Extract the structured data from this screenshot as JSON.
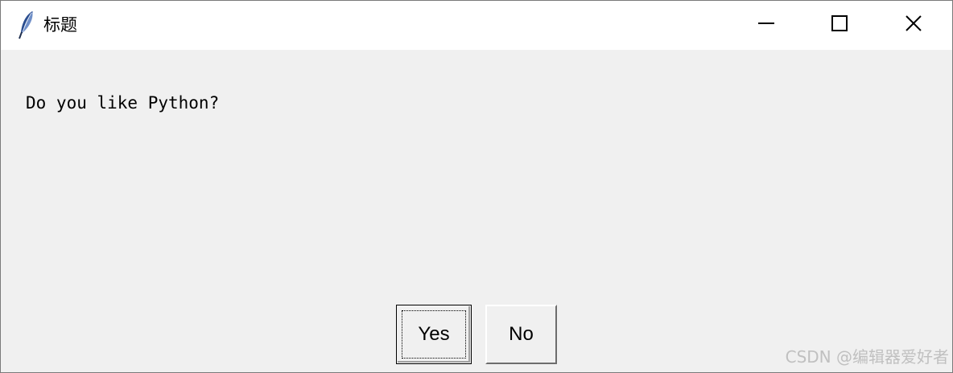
{
  "window": {
    "title": "标题",
    "icon": "feather-icon",
    "controls": {
      "minimize": "minimize-icon",
      "maximize": "maximize-icon",
      "close": "close-icon"
    }
  },
  "dialog": {
    "message": "Do you like Python?",
    "buttons": {
      "yes_label": "Yes",
      "no_label": "No"
    }
  },
  "watermark": "CSDN @编辑器爱好者",
  "colors": {
    "titlebar_bg": "#ffffff",
    "content_bg": "#f0f0f0",
    "feather_blue": "#2a4d8f"
  }
}
